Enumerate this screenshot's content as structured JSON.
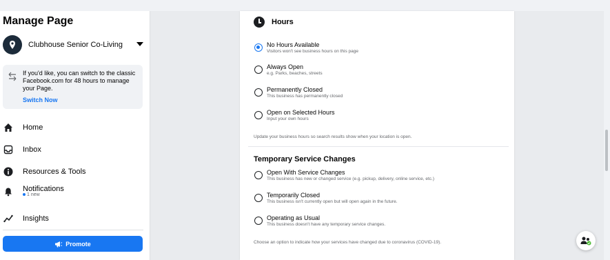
{
  "sidebar": {
    "title": "Manage Page",
    "page_name": "Clubhouse Senior Co-Living",
    "notice": {
      "text": "If you'd like, you can switch to the classic Facebook.com for 48 hours to manage your Page.",
      "link": "Switch Now"
    },
    "nav": [
      {
        "label": "Home",
        "icon": "home-icon"
      },
      {
        "label": "Inbox",
        "icon": "inbox-icon"
      },
      {
        "label": "Resources & Tools",
        "icon": "info-icon"
      },
      {
        "label": "Notifications",
        "icon": "bell-icon",
        "sub": "1 new"
      },
      {
        "label": "Insights",
        "icon": "insights-icon"
      }
    ],
    "promote_label": "Promote"
  },
  "hours": {
    "title": "Hours",
    "options": [
      {
        "label": "No Hours Available",
        "desc": "Visitors won't see business hours on this page",
        "selected": true
      },
      {
        "label": "Always Open",
        "desc": "e.g. Parks, beaches, streets",
        "selected": false
      },
      {
        "label": "Permanently Closed",
        "desc": "This business has permanently closed",
        "selected": false
      },
      {
        "label": "Open on Selected Hours",
        "desc": "Input your own hours",
        "selected": false
      }
    ],
    "helper": "Update your business hours so search results show when your location is open."
  },
  "temporary": {
    "title": "Temporary Service Changes",
    "options": [
      {
        "label": "Open With Service Changes",
        "desc": "This business has new or changed service (e.g. pickup, delivery, online service, etc.)",
        "selected": false
      },
      {
        "label": "Temporarily Closed",
        "desc": "This business isn't currently open but will open again in the future.",
        "selected": false
      },
      {
        "label": "Operating as Usual",
        "desc": "This business doesn't have any temporary service changes.",
        "selected": false
      }
    ],
    "helper": "Choose an option to indicate how your services have changed due to coronavirus (COVID-19)."
  },
  "colors": {
    "accent": "#1877f2",
    "text": "#050505",
    "muted": "#65676b"
  }
}
